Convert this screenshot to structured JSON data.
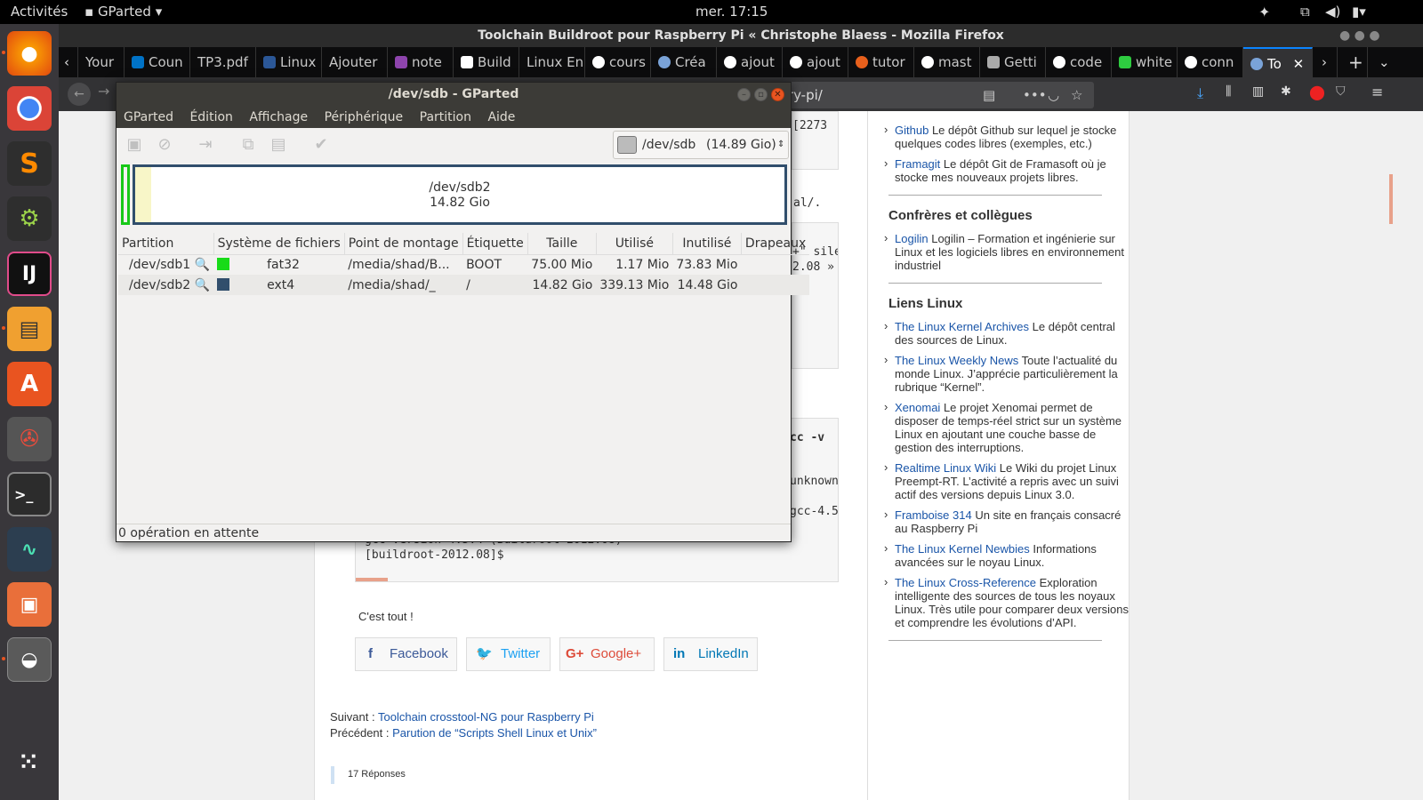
{
  "topbar": {
    "activities": "Activités",
    "app": "GParted",
    "clock": "mer. 17:15"
  },
  "firefox": {
    "title": "Toolchain Buildroot pour Raspberry Pi « Christophe Blaess - Mozilla Firefox",
    "tabs": [
      "Your",
      "Coun",
      "TP3.pdf",
      "Linux",
      "Ajouter",
      "note",
      "Build",
      "Linux En",
      "cours",
      "Créa",
      "ajout",
      "ajout",
      "tutor",
      "mast",
      "Getti",
      "code",
      "white",
      "conn",
      "To"
    ],
    "url_tail": "rry-pi/"
  },
  "article": {
    "code1_frag": "[2273",
    "frag_al": "al/.",
    "code2_l1": "+\" sile",
    "code2_l2": "2.08 »",
    "code3_l1": "cc -v",
    "code3_l2": "unknown",
    "code3_l3": "gcc-4.5",
    "code3_l4": "gcc version 4.5.4 (Buildroot 2012.08)",
    "code3_l5": "[buildroot-2012.08]$",
    "cest_tout": "C'est tout !",
    "share": {
      "facebook": "Facebook",
      "twitter": "Twitter",
      "google": "Google+",
      "linkedin": "LinkedIn"
    },
    "next_label": "Suivant :",
    "next_link": "Toolchain crosstool-NG pour Raspberry Pi",
    "prev_label": "Précédent :",
    "prev_link": "Parution de “Scripts Shell Linux et Unix”",
    "replies": "17 Réponses"
  },
  "sidebar": {
    "items_top": [
      {
        "link": "Github",
        "text": "Le dépôt Github sur lequel je stocke quelques codes libres (exemples, etc.)"
      },
      {
        "link": "Framagit",
        "text": "Le dépôt Git de Framasoft où je stocke mes nouveaux projets libres."
      }
    ],
    "confreres_title": "Confrères et collègues",
    "confreres": [
      {
        "link": "Logilin",
        "text": "Logilin – Formation et ingénierie sur Linux et les logiciels libres en environnement industriel"
      }
    ],
    "liens_title": "Liens Linux",
    "liens": [
      {
        "link": "The Linux Kernel Archives",
        "text": "Le dépôt central des sources de Linux."
      },
      {
        "link": "The Linux Weekly News",
        "text": "Toute l’actualité du monde Linux. J’apprécie particulièrement la rubrique “Kernel”."
      },
      {
        "link": "Xenomai",
        "text": "Le projet Xenomai permet de disposer de temps-réel strict sur un système Linux en ajoutant une couche basse de gestion des interruptions."
      },
      {
        "link": "Realtime Linux Wiki",
        "text": "Le Wiki du projet Linux Preempt-RT. L’activité a repris avec un suivi actif des versions depuis Linux 3.0."
      },
      {
        "link": "Framboise 314",
        "text": "Un site en français consacré au Raspberry Pi"
      },
      {
        "link": "The Linux Kernel Newbies",
        "text": "Informations avancées sur le noyau Linux."
      },
      {
        "link": "The Linux Cross-Reference",
        "text": "Exploration intelligente des sources de tous les noyaux Linux. Très utile pour comparer deux versions et comprendre les évolutions d’API."
      }
    ]
  },
  "gparted": {
    "title": "/dev/sdb - GParted",
    "menu": [
      "GParted",
      "Édition",
      "Affichage",
      "Périphérique",
      "Partition",
      "Aide"
    ],
    "device": "/dev/sdb",
    "device_size": "(14.89 Gio)",
    "graph_name": "/dev/sdb2",
    "graph_size": "14.82 Gio",
    "columns": [
      "Partition",
      "Système de fichiers",
      "Point de montage",
      "Étiquette",
      "Taille",
      "Utilisé",
      "Inutilisé",
      "Drapeaux"
    ],
    "rows": [
      {
        "partition": "/dev/sdb1",
        "fs": "fat32",
        "fs_color": "#18db18",
        "mount": "/media/shad/B...",
        "label": "BOOT",
        "size": "75.00 Mio",
        "used": "1.17 Mio",
        "unused": "73.83 Mio",
        "flags": ""
      },
      {
        "partition": "/dev/sdb2",
        "fs": "ext4",
        "fs_color": "#314e6c",
        "mount": "/media/shad/_",
        "label": "/",
        "size": "14.82 Gio",
        "used": "339.13 Mio",
        "unused": "14.48 Gio",
        "flags": ""
      }
    ],
    "status": "0 opération en attente"
  }
}
